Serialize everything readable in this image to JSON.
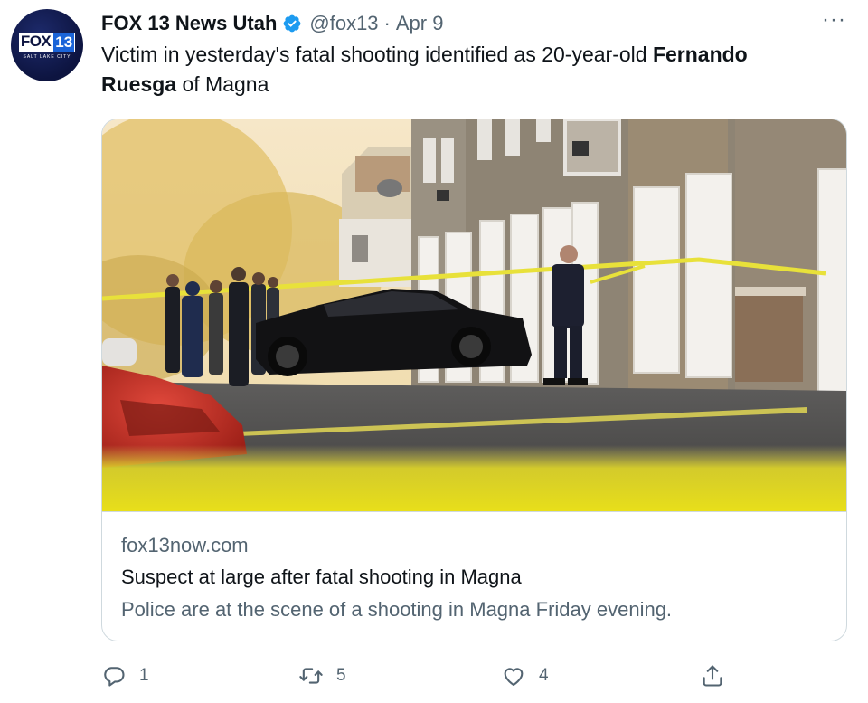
{
  "account": {
    "avatar_logo_main": "FOX",
    "avatar_logo_number": "13",
    "avatar_logo_sub": "SALT LAKE CITY",
    "name": "FOX 13 News Utah",
    "handle": "@fox13",
    "separator": "·",
    "date": "Apr 9",
    "verified_icon": "verified-badge-icon",
    "accent_color": "#1d9bf0"
  },
  "tweet": {
    "text_before": "Victim in yesterday's fatal shooting identified as 20-year-old ",
    "text_bold": "Fernando Ruesga",
    "text_after": " of Magna"
  },
  "more_menu": {
    "label": "···",
    "icon": "more-options-icon"
  },
  "card": {
    "image_icon": "crime-scene-photo",
    "domain": "fox13now.com",
    "title": "Suspect at large after fatal shooting in Magna",
    "description": "Police are at the scene of a shooting in Magna Friday evening."
  },
  "actions": {
    "reply": {
      "icon": "reply-icon",
      "count": "1"
    },
    "retweet": {
      "icon": "retweet-icon",
      "count": "5"
    },
    "like": {
      "icon": "heart-icon",
      "count": "4"
    },
    "share": {
      "icon": "share-icon",
      "count": ""
    }
  },
  "colors": {
    "text_primary": "#0f1419",
    "text_secondary": "#536471",
    "border": "#cfd9de"
  }
}
